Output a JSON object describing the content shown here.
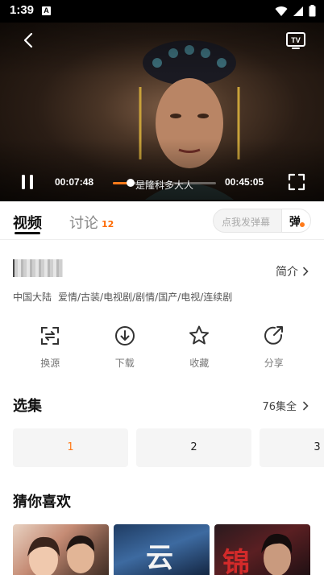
{
  "status_bar": {
    "time": "1:39",
    "notification_badge": "A"
  },
  "player": {
    "current_time": "00:07:48",
    "total_time": "00:45:05",
    "progress": 0.173,
    "danmaku_text": "是隆科多大人",
    "accent_color": "#ff7a1a"
  },
  "tabs": {
    "video_label": "视频",
    "discuss_label": "讨论",
    "discuss_count": "12",
    "danmu_placeholder": "点我发弹幕",
    "danmu_button": "弹"
  },
  "info": {
    "intro_label": "简介",
    "tags": [
      "中国大陆",
      "爱情/古装/电视剧/剧情/国产/电视/连续剧"
    ]
  },
  "actions": [
    {
      "label": "换源",
      "icon": "switch-source-icon"
    },
    {
      "label": "下载",
      "icon": "download-icon"
    },
    {
      "label": "收藏",
      "icon": "star-icon"
    },
    {
      "label": "分享",
      "icon": "share-icon"
    }
  ],
  "episodes": {
    "title": "选集",
    "more_label": "76集全",
    "items": [
      "1",
      "2",
      "3"
    ],
    "active_index": 0
  },
  "recommend": {
    "title": "猜你喜欢",
    "posters": [
      {
        "glyph": ""
      },
      {
        "glyph": "云"
      },
      {
        "glyph": "锦"
      }
    ]
  }
}
